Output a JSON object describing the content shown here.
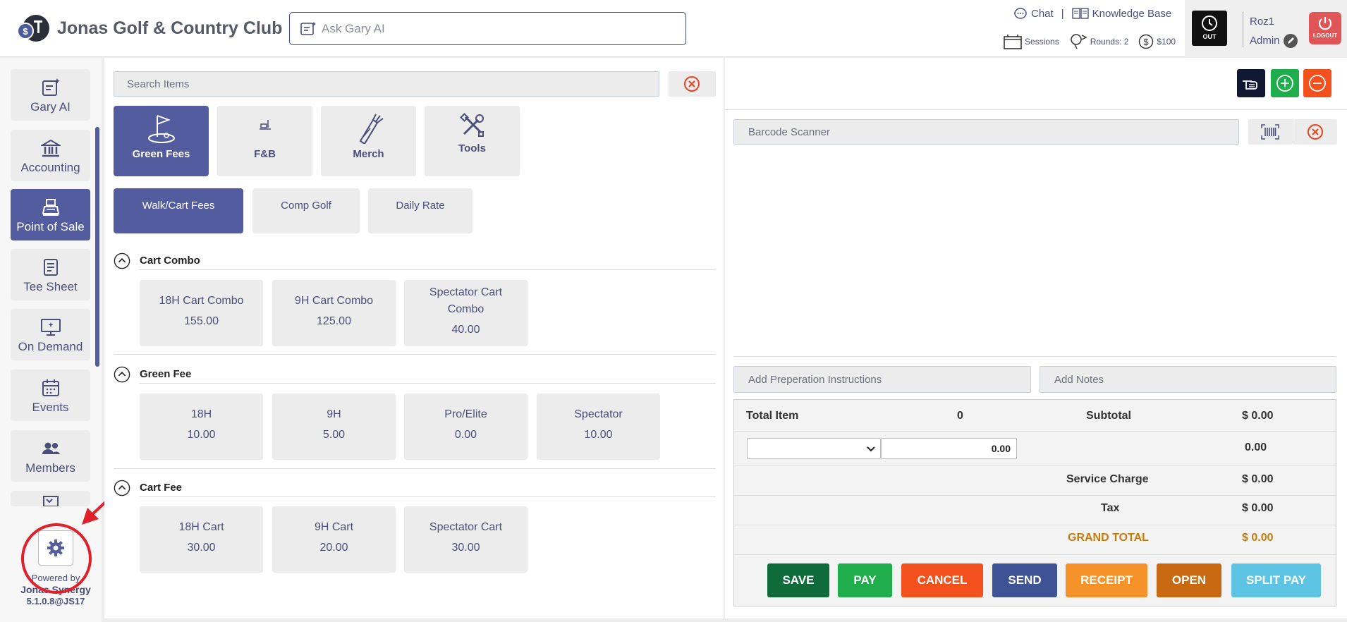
{
  "header": {
    "club_name": "Jonas Golf & Country Club",
    "ask_placeholder": "Ask Gary AI",
    "chat_label": "Chat",
    "separator": "|",
    "knowledge_label": "Knowledge Base",
    "sessions_label": "Sessions",
    "rounds_label": "Rounds: 2",
    "money_label": "$100",
    "out_label": "OUT",
    "user_name": "Roz1",
    "user_role": "Admin",
    "logout_label": "LOGOUT"
  },
  "sidebar": {
    "items": [
      {
        "label": "Gary AI",
        "icon": "gary-ai-icon"
      },
      {
        "label": "Accounting",
        "icon": "bank-icon"
      },
      {
        "label": "Point of Sale",
        "icon": "register-icon"
      },
      {
        "label": "Tee Sheet",
        "icon": "sheet-icon"
      },
      {
        "label": "On Demand",
        "icon": "monitor-icon"
      },
      {
        "label": "Events",
        "icon": "calendar-icon"
      },
      {
        "label": "Members",
        "icon": "users-icon"
      }
    ],
    "powered_by": "Powered by",
    "product": "Jonas Synergy",
    "version": "5.1.0.8@JS17"
  },
  "pos": {
    "search_placeholder": "Search Items",
    "categories": [
      {
        "label": "Green Fees",
        "icon": "golf-flag-icon"
      },
      {
        "label": "F&B",
        "icon": "food-icon"
      },
      {
        "label": "Merch",
        "icon": "golf-bag-icon"
      },
      {
        "label": "Tools",
        "icon": "tools-icon"
      }
    ],
    "subtabs": [
      "Walk/Cart Fees",
      "Comp Golf",
      "Daily Rate"
    ],
    "sections": [
      {
        "title": "Cart Combo",
        "items": [
          {
            "name": "18H Cart Combo",
            "price": "155.00"
          },
          {
            "name": "9H Cart Combo",
            "price": "125.00"
          },
          {
            "name": "Spectator Cart Combo",
            "price": "40.00"
          }
        ]
      },
      {
        "title": "Green Fee",
        "items": [
          {
            "name": "18H",
            "price": "10.00"
          },
          {
            "name": "9H",
            "price": "5.00"
          },
          {
            "name": "Pro/Elite",
            "price": "0.00"
          },
          {
            "name": "Spectator",
            "price": "10.00"
          }
        ]
      },
      {
        "title": "Cart Fee",
        "items": [
          {
            "name": "18H Cart",
            "price": "30.00"
          },
          {
            "name": "9H Cart",
            "price": "20.00"
          },
          {
            "name": "Spectator Cart",
            "price": "30.00"
          }
        ]
      }
    ]
  },
  "order": {
    "barcode_placeholder": "Barcode Scanner",
    "prep_placeholder": "Add Preperation Instructions",
    "notes_placeholder": "Add Notes",
    "total_item_label": "Total Item",
    "total_item_value": "0",
    "subtotal_label": "Subtotal",
    "subtotal_value": "$ 0.00",
    "discount_input": "0.00",
    "discount_value": "0.00",
    "service_label": "Service Charge",
    "service_value": "$ 0.00",
    "tax_label": "Tax",
    "tax_value": "$ 0.00",
    "grand_label": "GRAND TOTAL",
    "grand_value": "$ 0.00",
    "buttons": [
      {
        "label": "SAVE",
        "color": "#0f6b3a"
      },
      {
        "label": "PAY",
        "color": "#1fae4b"
      },
      {
        "label": "CANCEL",
        "color": "#f2501c"
      },
      {
        "label": "SEND",
        "color": "#3e5295"
      },
      {
        "label": "RECEIPT",
        "color": "#f5922a"
      },
      {
        "label": "OPEN",
        "color": "#c96a12"
      },
      {
        "label": "SPLIT PAY",
        "color": "#5dc4e3"
      }
    ]
  },
  "colors": {
    "accent": "#535c9e",
    "grand_total": "#c97a0c",
    "annotation": "#e0202a"
  }
}
